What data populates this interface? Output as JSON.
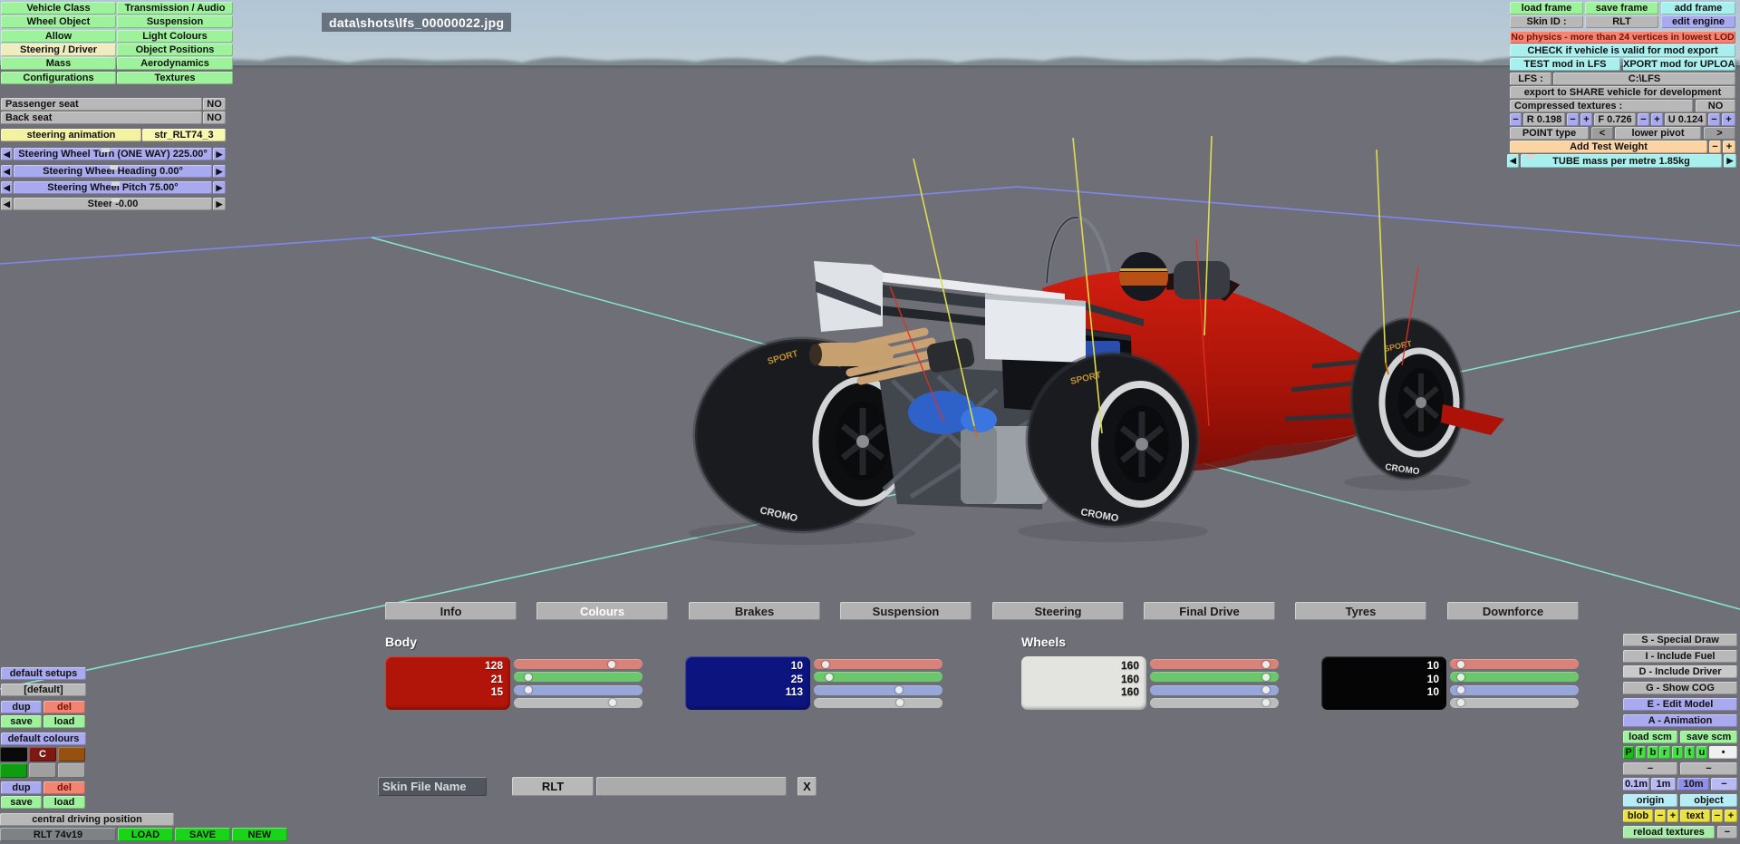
{
  "viewport": {
    "filename": "data\\shots\\lfs_00000022.jpg",
    "tyre_text_top": "SPORT",
    "tyre_text_bottom": "CROMO"
  },
  "icons": {
    "arrow_left": "◀",
    "arrow_right": "▶",
    "minus": "−",
    "plus": "+",
    "angle_left": "<",
    "angle_right": ">",
    "bullet": "•"
  },
  "left_panel": {
    "menu": [
      "Vehicle Class",
      "Transmission / Audio",
      "Wheel Object",
      "Suspension",
      "Allow",
      "Light Colours",
      "Steering / Driver",
      "Object Positions",
      "Mass",
      "Aerodynamics",
      "Configurations",
      "Textures"
    ],
    "selected_menu": "Steering / Driver",
    "passenger_seat": {
      "label": "Passenger seat",
      "value": "NO"
    },
    "back_seat": {
      "label": "Back seat",
      "value": "NO"
    },
    "steering_animation": {
      "label": "steering animation",
      "value": "str_RLT74_3"
    },
    "sliders": [
      {
        "label": "Steering Wheel Turn (ONE WAY) 225.00°",
        "marker_pct": 46,
        "style": "purple"
      },
      {
        "label": "Steering Wheel Heading 0.00°",
        "marker_pct": 50,
        "style": "purple"
      },
      {
        "label": "Steering Wheel Pitch 75.00°",
        "marker_pct": 51,
        "style": "purple"
      },
      {
        "label": "Steer -0.00",
        "marker_pct": 51,
        "style": "gray"
      }
    ]
  },
  "top_right": {
    "load_frame": "load frame",
    "save_frame": "save frame",
    "add_frame": "add frame",
    "skin_id_label": "Skin ID :",
    "skin_id_value": "RLT",
    "edit_engine": "edit engine",
    "warning": "No physics - more than 24 vertices in lowest LOD",
    "check": "CHECK if vehicle is valid for mod export",
    "test_mod": "TEST mod in LFS",
    "export_mod": "EXPORT mod for UPLOAD",
    "lfs_label": "LFS :",
    "lfs_path": "C:\\LFS",
    "share": "export to SHARE vehicle for development",
    "compressed_label": "Compressed textures :",
    "compressed_value": "NO",
    "r_value": "R 0.198",
    "f_value": "F 0.726",
    "u_value": "U 0.124",
    "point_type": "POINT type",
    "lower_pivot": "lower pivot",
    "add_test_weight": "Add Test Weight",
    "tube_mass": "TUBE mass per metre 1.85kg",
    "tube_marker_pct": 4
  },
  "tabs": {
    "items": [
      "Info",
      "Colours",
      "Brakes",
      "Suspension",
      "Steering",
      "Final Drive",
      "Tyres",
      "Downforce"
    ],
    "selected": "Colours"
  },
  "colours": {
    "body_header": "Body",
    "wheels_header": "Wheels",
    "slider_colors": [
      "#d9827a",
      "#6cc66c",
      "#97a7d8",
      "#bcbcbc"
    ],
    "groups": [
      {
        "section": "body",
        "swatch": "#b11408",
        "values": [
          "128",
          "21",
          "15"
        ],
        "handles_pct": [
          79,
          6,
          6,
          80
        ]
      },
      {
        "section": "body",
        "swatch": "#0c147f",
        "values": [
          "10",
          "25",
          "113"
        ],
        "handles_pct": [
          4,
          7,
          68,
          69
        ]
      },
      {
        "section": "wheels",
        "swatch": "#e3e3e0",
        "values": [
          "160",
          "160",
          "160"
        ],
        "handles_pct": [
          95,
          95,
          95,
          95
        ]
      },
      {
        "section": "wheels",
        "swatch": "#050505",
        "values": [
          "10",
          "10",
          "10"
        ],
        "handles_pct": [
          3,
          3,
          3,
          3
        ]
      }
    ]
  },
  "skin_row": {
    "label": "Skin File Name",
    "prefix": "RLT",
    "value": "",
    "close": "X"
  },
  "bottom_left": {
    "default_setups": "default setups",
    "current_setup": "[default]",
    "dup": "dup",
    "del": "del",
    "save": "save",
    "load": "load",
    "default_colours": "default colours",
    "colour_swatches": [
      {
        "color": "#0a0a0a",
        "label": ""
      },
      {
        "color": "#7e1812",
        "label": "C"
      },
      {
        "color": "#96500f",
        "label": ""
      },
      {
        "color": "#109c10",
        "label": ""
      },
      {
        "color": "#9f9f9f",
        "label": ""
      },
      {
        "color": "#a8a8a8",
        "label": ""
      }
    ],
    "central_driving_position": "central driving position",
    "vehicle_name": "RLT 74v19",
    "load_big": "LOAD",
    "save_big": "SAVE",
    "new_big": "NEW"
  },
  "bottom_right": {
    "toggles": [
      {
        "label": "S - Special Draw",
        "active": false
      },
      {
        "label": "I - Include Fuel",
        "active": false
      },
      {
        "label": "D - Include Driver",
        "active": true
      },
      {
        "label": "G - Show COG",
        "active": false
      }
    ],
    "edit_model": "E - Edit Model",
    "animation": "A - Animation",
    "load_scm": "load scm",
    "save_scm": "save scm",
    "model_keys": [
      "P",
      "f",
      "b",
      "r",
      "l",
      "t",
      "u",
      "•"
    ],
    "grid_sizes": [
      "0.1m",
      "1m",
      "10m"
    ],
    "grid_selected": "10m",
    "origin": "origin",
    "object": "object",
    "blob": "blob",
    "text": "text",
    "reload_textures": "reload textures"
  }
}
